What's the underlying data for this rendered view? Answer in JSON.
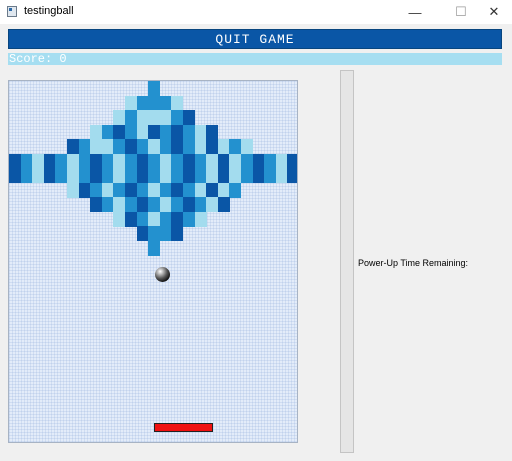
{
  "window": {
    "title": "testingball",
    "minimize_glyph": "—",
    "maximize_glyph": "☐",
    "close_glyph": "✕"
  },
  "controls": {
    "quit_label": "QUIT GAME"
  },
  "score": {
    "text": "Score: 0"
  },
  "power_up": {
    "label": "Power-Up Time Remaining:"
  },
  "colors": {
    "dark": "#0a56a6",
    "mid": "#2391cf",
    "light": "#a3dcee",
    "paddle": "#ef1111",
    "quit_button": "#0a56a6",
    "score_bar": "#a6def1"
  },
  "bricks": {
    "rows": [
      "............M............",
      "..........LMMML..........",
      ".........LMLLLMD.........",
      ".......LMDMLDMDMLD.......",
      ".....DMLLMDMLMDMLDLML....",
      "DMLDMLMDMLMDMLMDMLDLMDMLD",
      "DMLDMLMDMLMDMLMDMLDLMDMLD",
      ".....LDMLMDMLMDMLDLM.....",
      ".......DMLMDMLMDMLD......",
      ".........LDMLMDML........",
      "...........DMMD..........",
      "............M............"
    ]
  }
}
